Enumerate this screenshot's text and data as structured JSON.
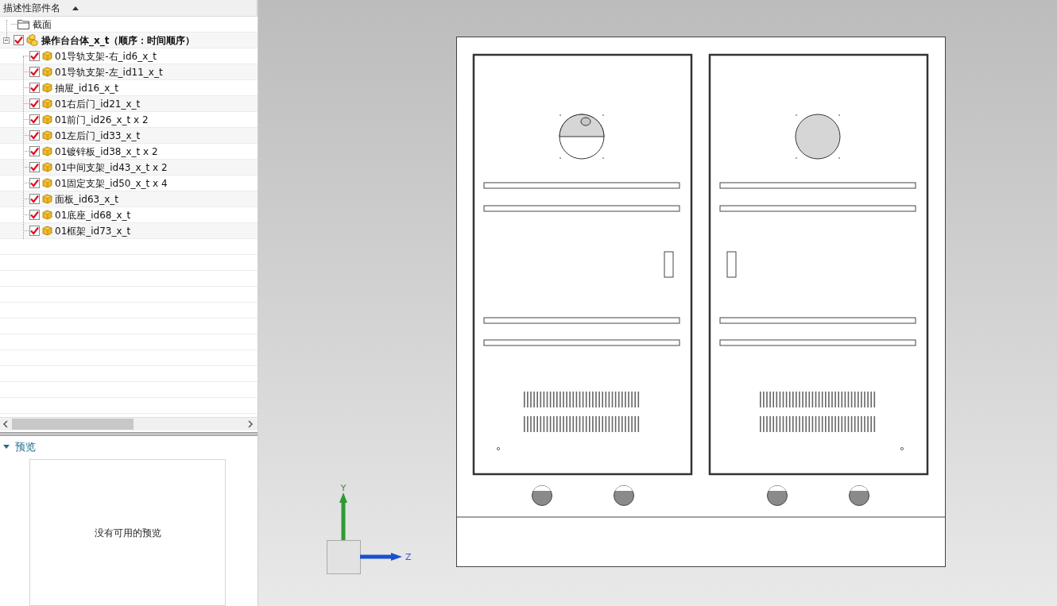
{
  "tree": {
    "column_header": "描述性部件名",
    "items": [
      {
        "kind": "folder",
        "label": "截面"
      },
      {
        "kind": "assembly",
        "label": "操作台台体_x_t（顺序：时间顺序）",
        "checked": true,
        "expanded": true,
        "children": [
          {
            "kind": "part",
            "label": "01导轨支架-右_id6_x_t",
            "checked": true
          },
          {
            "kind": "part",
            "label": "01导轨支架-左_id11_x_t",
            "checked": true
          },
          {
            "kind": "part",
            "label": "抽屉_id16_x_t",
            "checked": true
          },
          {
            "kind": "part",
            "label": "01右后门_id21_x_t",
            "checked": true
          },
          {
            "kind": "part",
            "label": "01前门_id26_x_t x 2",
            "checked": true
          },
          {
            "kind": "part",
            "label": "01左后门_id33_x_t",
            "checked": true
          },
          {
            "kind": "part",
            "label": "01镀锌板_id38_x_t x 2",
            "checked": true
          },
          {
            "kind": "part",
            "label": "01中间支架_id43_x_t x 2",
            "checked": true
          },
          {
            "kind": "part",
            "label": "01固定支架_id50_x_t x 4",
            "checked": true
          },
          {
            "kind": "part",
            "label": "面板_id63_x_t",
            "checked": true
          },
          {
            "kind": "part",
            "label": "01底座_id68_x_t",
            "checked": true
          },
          {
            "kind": "part",
            "label": "01框架_id73_x_t",
            "checked": true
          }
        ]
      }
    ]
  },
  "preview": {
    "title": "预览",
    "expanded": true,
    "message": "没有可用的预览"
  },
  "viewport": {
    "axes": [
      {
        "kind": "y",
        "label": "Y"
      },
      {
        "kind": "z",
        "label": "Z"
      }
    ]
  }
}
